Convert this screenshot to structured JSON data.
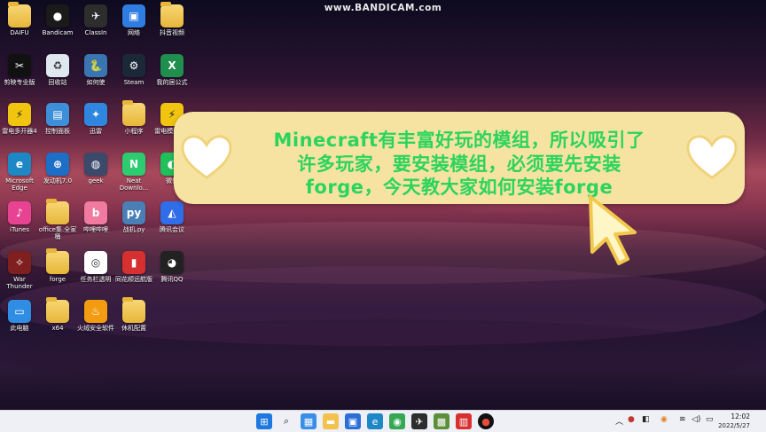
{
  "watermark": "www.BANDICAM.com",
  "desktop_icons": [
    {
      "label": "DAIFU",
      "icon": "folder-icon"
    },
    {
      "label": "Bandicam",
      "icon": "bandicam-icon"
    },
    {
      "label": "ClassIn",
      "icon": "classin-icon"
    },
    {
      "label": "网络",
      "icon": "network-icon"
    },
    {
      "label": "抖音视频",
      "icon": "folder-icon"
    },
    {
      "label": "剪映专业版",
      "icon": "capcut-icon"
    },
    {
      "label": "回收站",
      "icon": "recycle-bin-icon"
    },
    {
      "label": "如何使",
      "icon": "python-icon"
    },
    {
      "label": "Steam",
      "icon": "steam-icon"
    },
    {
      "label": "我的居公式",
      "icon": "excel-icon"
    },
    {
      "label": "雷电多开器4",
      "icon": "ldmulti-icon"
    },
    {
      "label": "控制面板",
      "icon": "control-panel-icon"
    },
    {
      "label": "迅雷",
      "icon": "xunlei-icon"
    },
    {
      "label": "小程序",
      "icon": "folder-icon"
    },
    {
      "label": "雷电模拟器4",
      "icon": "ldplayer-icon"
    },
    {
      "label": "Microsoft\nEdge",
      "icon": "edge-icon"
    },
    {
      "label": "发动机7.0",
      "icon": "app-icon"
    },
    {
      "label": "geek",
      "icon": "geek-icon"
    },
    {
      "label": "Neat\nDownlo...",
      "icon": "neat-download-icon"
    },
    {
      "label": "微信",
      "icon": "wechat-icon"
    },
    {
      "label": "iTunes",
      "icon": "itunes-icon"
    },
    {
      "label": "office集.全家\n桶",
      "icon": "folder-icon"
    },
    {
      "label": "哔哩哔哩",
      "icon": "bilibili-icon"
    },
    {
      "label": "战机.py",
      "icon": "python-file-icon"
    },
    {
      "label": "腾讯会议",
      "icon": "tencent-meeting-icon"
    },
    {
      "label": "War\nThunder",
      "icon": "warthunder-icon"
    },
    {
      "label": "forge",
      "icon": "folder-icon"
    },
    {
      "label": "任务栏透明",
      "icon": "translucenttb-icon"
    },
    {
      "label": "同花顺远航版",
      "icon": "tonghuashun-icon"
    },
    {
      "label": "腾讯QQ",
      "icon": "qq-icon"
    },
    {
      "label": "此电脑",
      "icon": "this-pc-icon"
    },
    {
      "label": "x64",
      "icon": "folder-icon"
    },
    {
      "label": "火绒安全软件",
      "icon": "huorong-icon"
    },
    {
      "label": "休机配置",
      "icon": "folder-icon"
    }
  ],
  "banner": {
    "line1": "Minecraft有丰富好玩的模组，所以吸引了",
    "line2": "许多玩家，要安装模组，必须要先安装",
    "line3": "forge，今天教大家如何安装forge"
  },
  "taskbar": {
    "icons": [
      "windows-start-icon",
      "search-icon",
      "widgets-icon",
      "file-explorer-icon",
      "store-icon",
      "edge-icon",
      "chrome-icon",
      "app-icon",
      "minecraft-icon",
      "calendar-app-icon",
      "bandicam-icon"
    ]
  },
  "tray": {
    "clock_time": "12:02",
    "clock_date": "2022/5/27"
  },
  "colors": {
    "banner_bg": "#f6e3a2",
    "banner_text": "#2bd45c",
    "taskbar_bg": "#eef0f6"
  }
}
